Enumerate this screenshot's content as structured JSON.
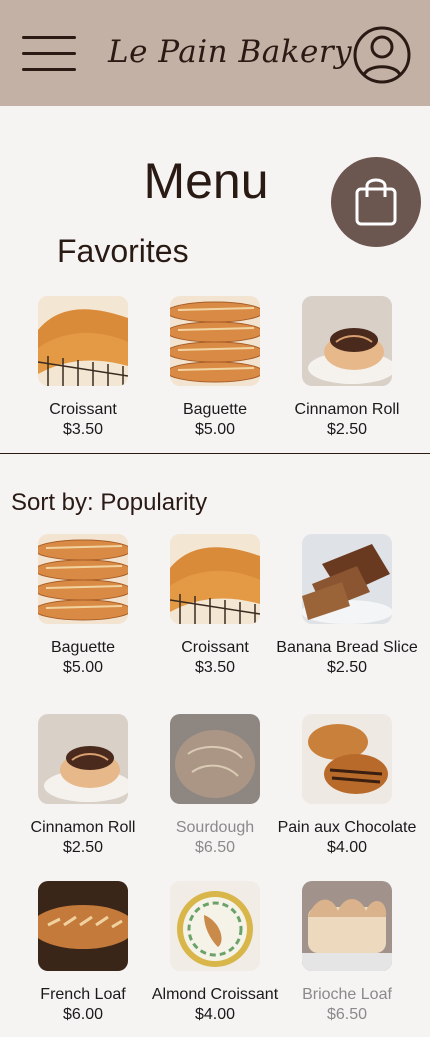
{
  "header": {
    "brand": "Le Pain Bakery",
    "bg_color": "#c4b1a5"
  },
  "main": {
    "title": "Menu",
    "favorites_title": "Favorites",
    "sort_label": "Sort by: Popularity"
  },
  "favorites": [
    {
      "name": "Croissant",
      "price": "$3.50",
      "image": "croissant"
    },
    {
      "name": "Baguette",
      "price": "$5.00",
      "image": "baguette"
    },
    {
      "name": "Cinnamon Roll",
      "price": "$2.50",
      "image": "cinnamon-roll"
    }
  ],
  "menu_items": [
    {
      "name": "Baguette",
      "price": "$5.00",
      "image": "baguette",
      "available": true
    },
    {
      "name": "Croissant",
      "price": "$3.50",
      "image": "croissant",
      "available": true
    },
    {
      "name": "Banana Bread Slice",
      "price": "$2.50",
      "image": "banana-bread",
      "available": true
    },
    {
      "name": "Cinnamon Roll",
      "price": "$2.50",
      "image": "cinnamon-roll",
      "available": true
    },
    {
      "name": "Sourdough",
      "price": "$6.50",
      "image": "sourdough",
      "available": false
    },
    {
      "name": "Pain aux Chocolate",
      "price": "$4.00",
      "image": "pain-au-chocolat",
      "available": true
    },
    {
      "name": "French Loaf",
      "price": "$6.00",
      "image": "french-loaf",
      "available": true
    },
    {
      "name": "Almond Croissant",
      "price": "$4.00",
      "image": "almond-croissant",
      "available": true
    },
    {
      "name": "Brioche Loaf",
      "price": "$6.50",
      "image": "brioche-loaf",
      "available": false
    }
  ],
  "colors": {
    "page_bg": "#f6f3f3",
    "cart_button": "#6b5650",
    "text": "#2a1a14",
    "unavailable_text": "#8a8a8a"
  }
}
